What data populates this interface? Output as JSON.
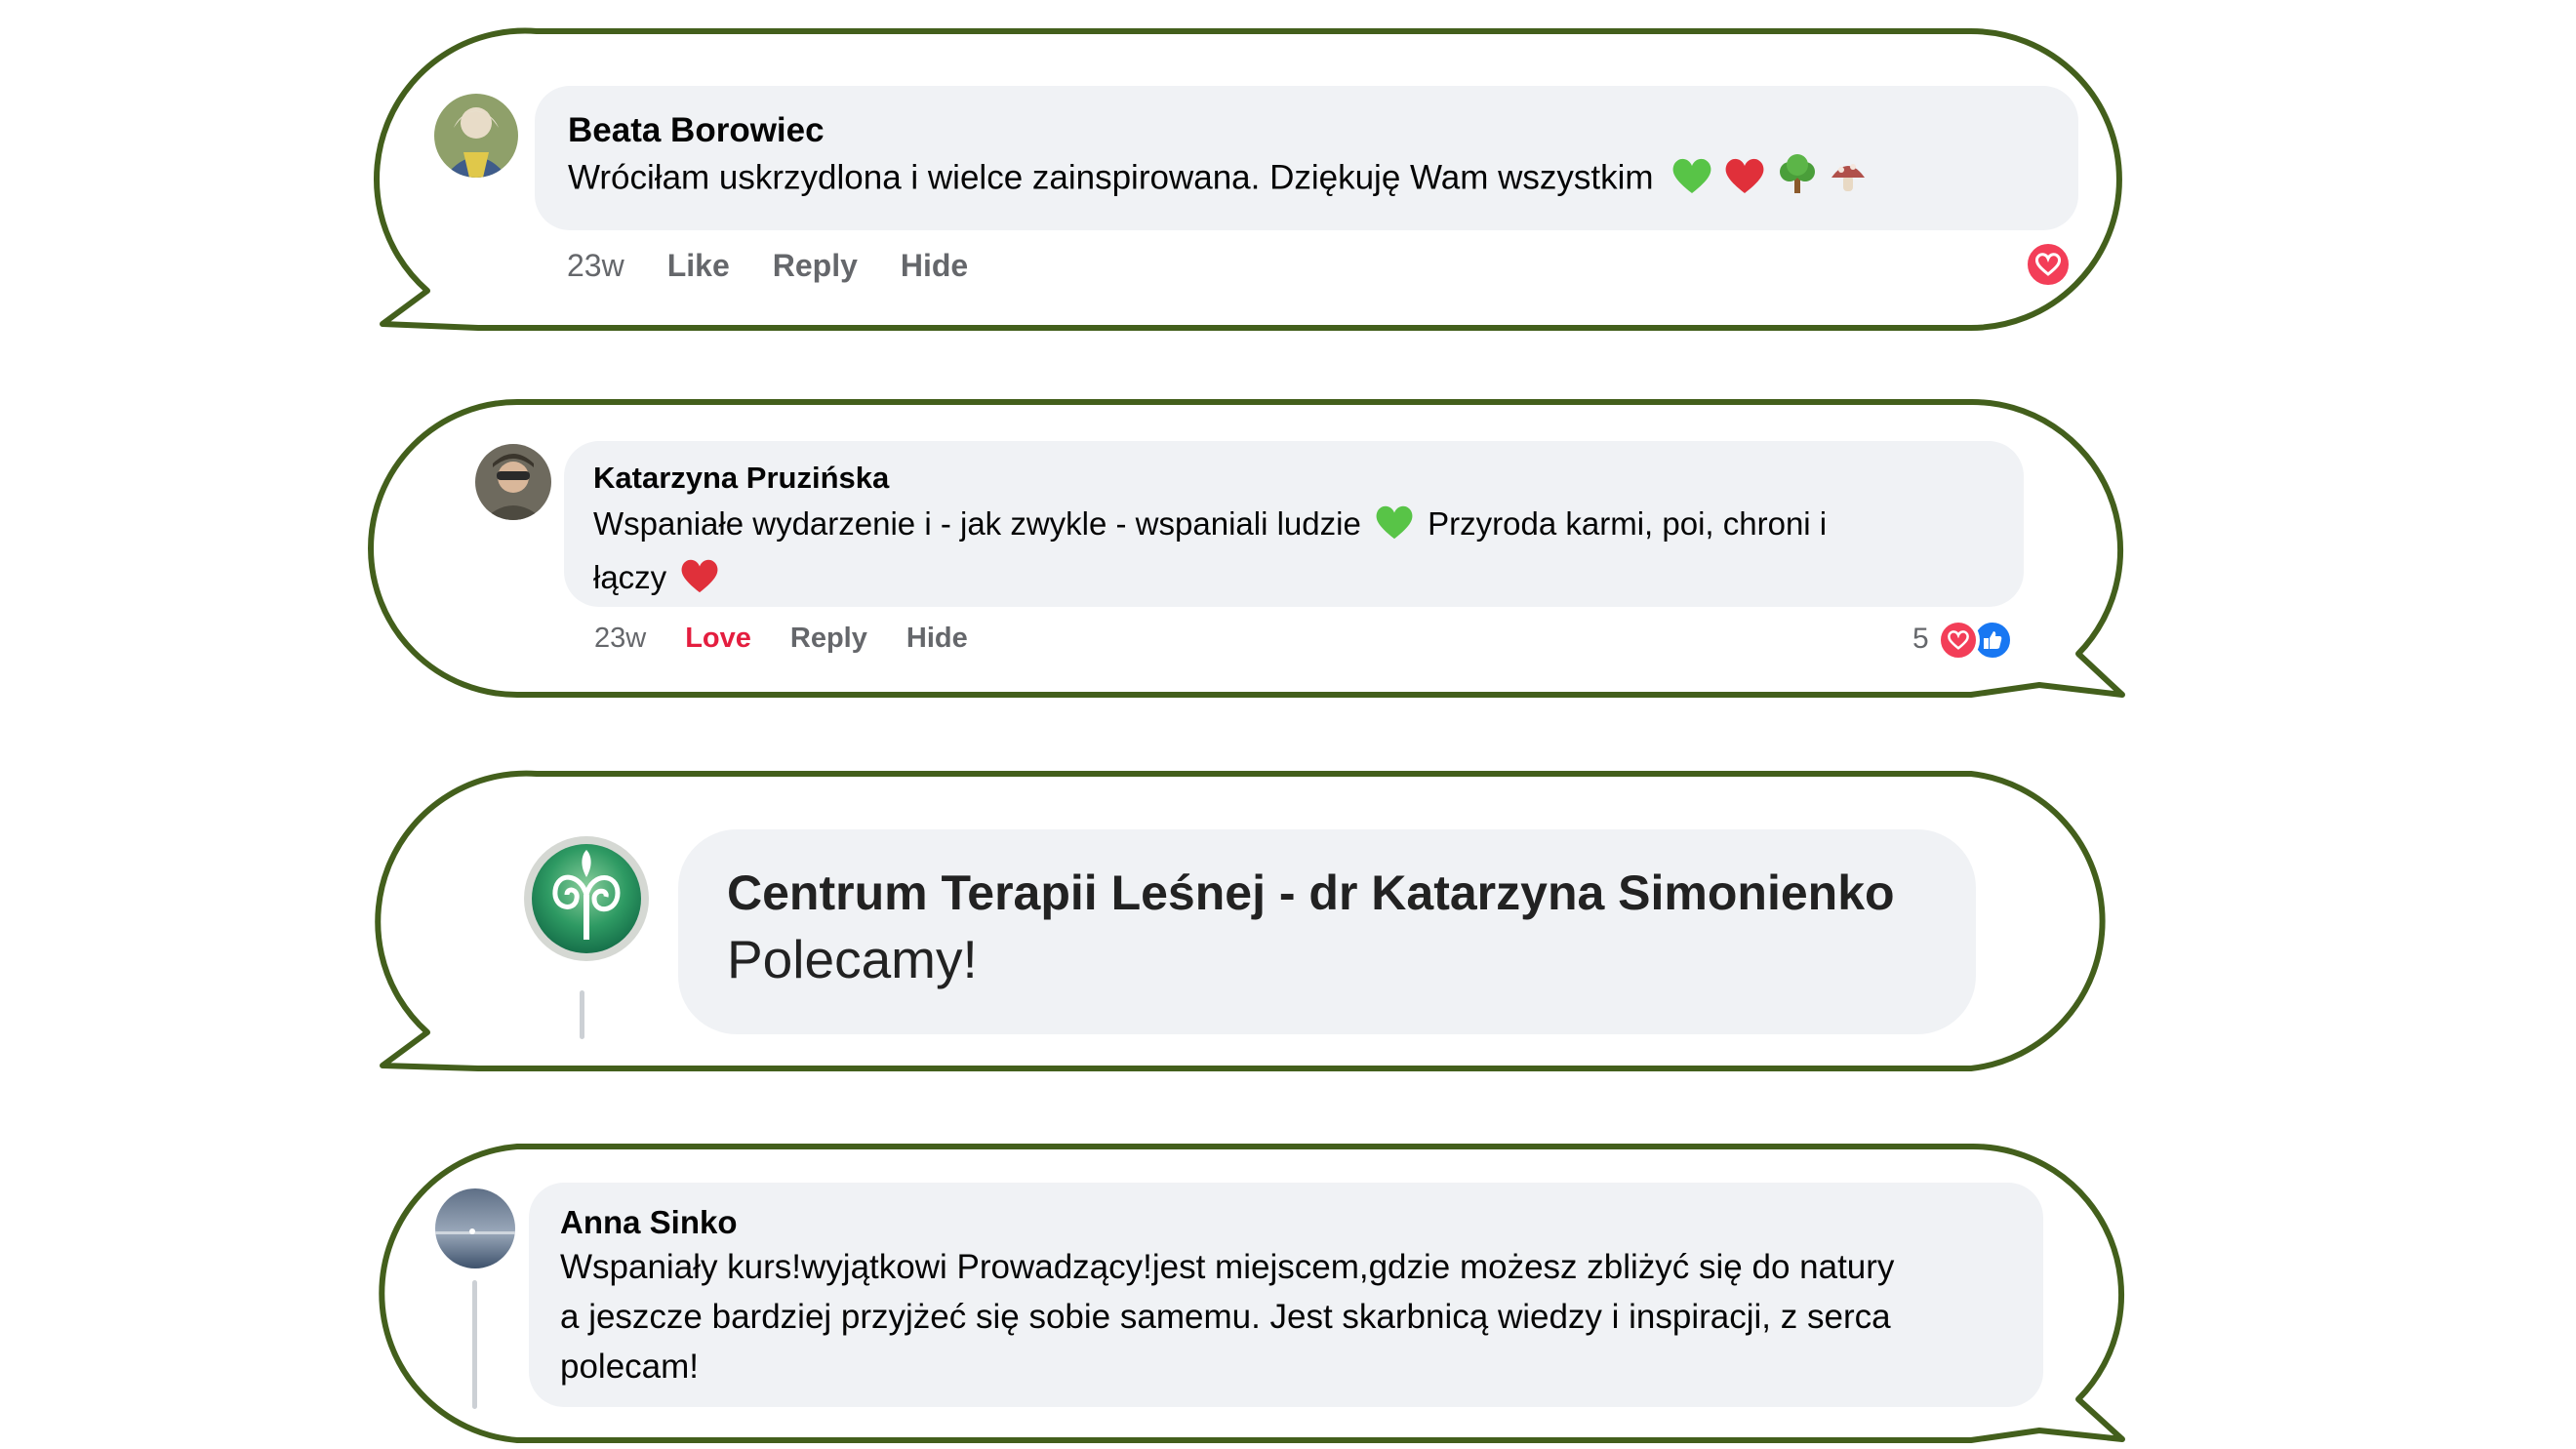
{
  "colors": {
    "frame_stroke": "#435f1c",
    "bubble_bg": "#f0f2f5",
    "meta_text": "#65676b",
    "love_text": "#e41e3f",
    "heart_reaction": "#f33e58",
    "like_reaction": "#1877f2"
  },
  "comments": [
    {
      "author": "Beata Borowiec",
      "text": "Wróciłam uskrzydlona i wielce zainspirowana. Dziękuję Wam wszystkim",
      "emojis": [
        "green-heart-emoji",
        "red-heart-emoji",
        "tree-emoji",
        "mushroom-emoji"
      ],
      "time": "23w",
      "actions": [
        "Like",
        "Reply",
        "Hide"
      ],
      "reactions": [
        "heart-reaction-icon"
      ]
    },
    {
      "author": "Katarzyna Pruzińska",
      "text_part1": "Wspaniałe wydarzenie i - jak zwykle - wspaniali ludzie",
      "text_part2": "Przyroda karmi, poi, chroni i",
      "text_part3": "łączy",
      "time": "23w",
      "actions": [
        "Love",
        "Reply",
        "Hide"
      ],
      "reaction_count": "5",
      "reactions": [
        "heart-reaction-icon",
        "like-reaction-icon"
      ]
    },
    {
      "author": "Centrum Terapii Leśnej - dr Katarzyna Simonienko",
      "text": "Polecamy!"
    },
    {
      "author": "Anna Sinko",
      "lines": [
        "Wspaniały kurs!wyjątkowi Prowadzący!jest miejscem,gdzie możesz zbliżyć się do natury",
        "a jeszcze bardziej przyjżeć się sobie samemu. Jest skarbnicą wiedzy i inspiracji, z serca",
        "polecam!"
      ]
    }
  ]
}
